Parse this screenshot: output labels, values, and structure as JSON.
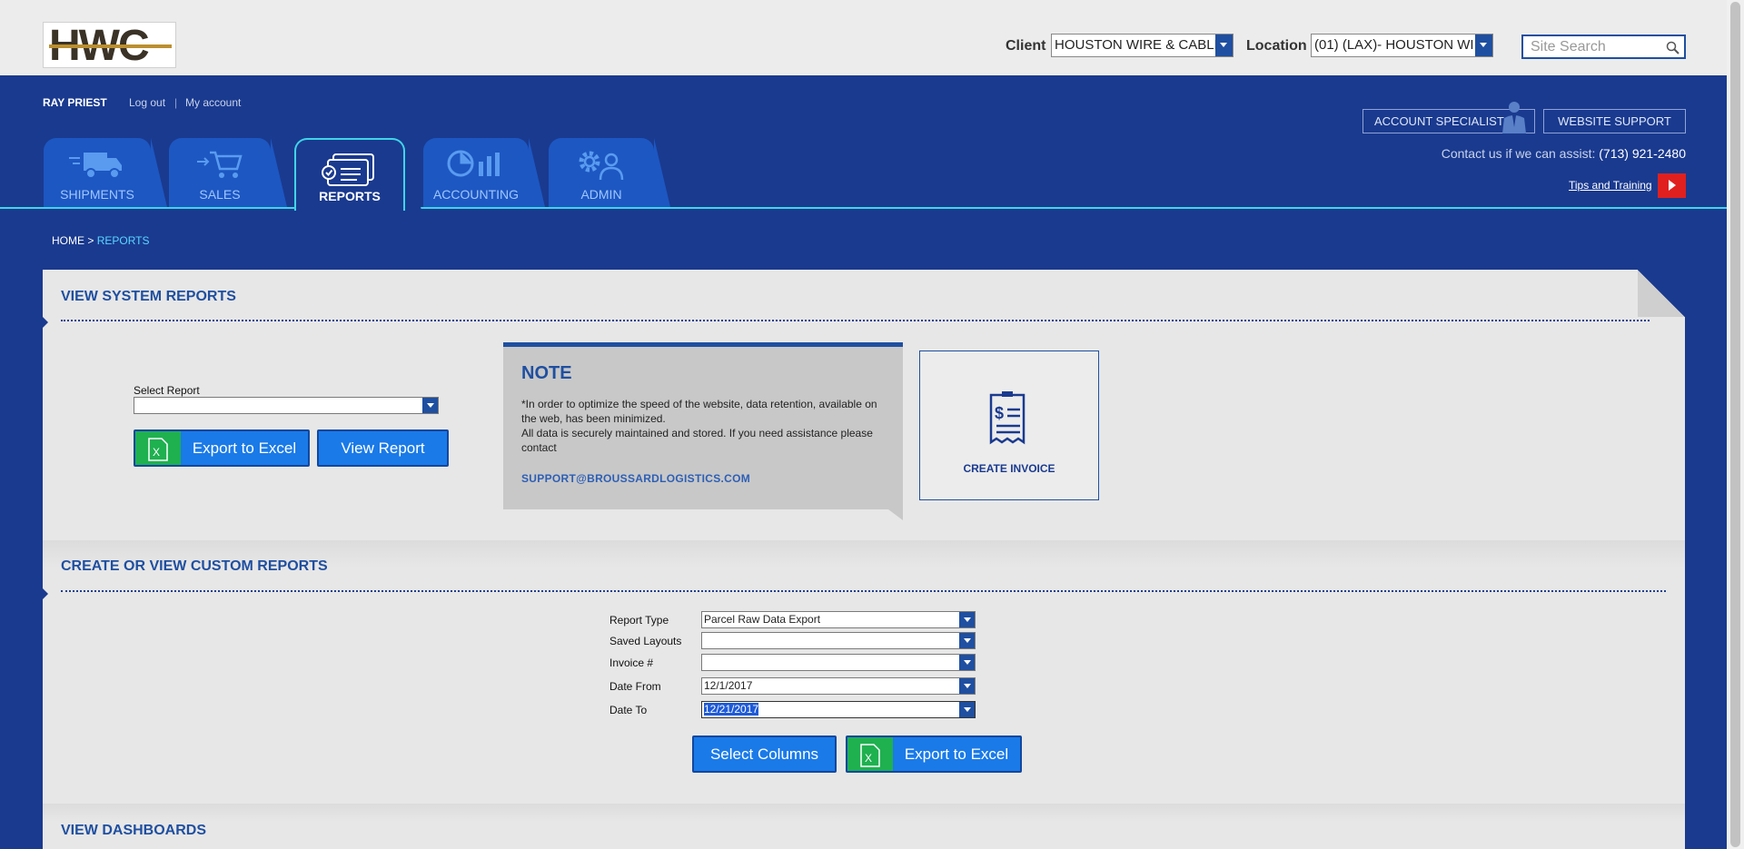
{
  "logo": {
    "text": "HWC"
  },
  "topbar": {
    "client_label": "Client",
    "client_value": "HOUSTON WIRE & CABLE",
    "location_label": "Location",
    "location_value": "(01) (LAX)- HOUSTON WI",
    "search_placeholder": "Site Search"
  },
  "user": {
    "name": "RAY PRIEST",
    "logout": "Log out",
    "separator": "|",
    "account": "My account"
  },
  "tabs": [
    {
      "label": "SHIPMENTS",
      "icon": "truck-icon"
    },
    {
      "label": "SALES",
      "icon": "cart-icon"
    },
    {
      "label": "REPORTS",
      "icon": "reports-icon",
      "active": true
    },
    {
      "label": "ACCOUNTING",
      "icon": "chart-icon"
    },
    {
      "label": "ADMIN",
      "icon": "admin-gear-icon"
    }
  ],
  "support": {
    "account_specialist": "ACCOUNT SPECIALIST",
    "website_support": "WEBSITE SUPPORT",
    "contact_text": "Contact us if we can assist:",
    "phone": "(713) 921-2480",
    "tips": "Tips and Training"
  },
  "breadcrumb": {
    "home": "HOME",
    "sep": ">",
    "current": "REPORTS"
  },
  "system_reports": {
    "title": "VIEW SYSTEM REPORTS",
    "select_label": "Select Report",
    "select_value": "",
    "export_label": "Export to Excel",
    "view_label": "View Report"
  },
  "note": {
    "title": "NOTE",
    "line1": "*In order to optimize the speed of the website, data retention, available on the web, has been minimized.",
    "line2": "All data is securely maintained and stored. If you need assistance please contact",
    "email": "SUPPORT@BROUSSARDLOGISTICS.COM"
  },
  "invoice": {
    "label": "CREATE INVOICE"
  },
  "custom_reports": {
    "title": "CREATE OR VIEW CUSTOM REPORTS",
    "fields": [
      {
        "label": "Report Type",
        "value": "Parcel Raw Data Export"
      },
      {
        "label": "Saved Layouts",
        "value": ""
      },
      {
        "label": "Invoice #",
        "value": ""
      },
      {
        "label": "Date From",
        "value": "12/1/2017"
      },
      {
        "label": "Date To",
        "value": "12/21/2017"
      }
    ],
    "select_columns": "Select Columns",
    "export_label": "Export to Excel"
  },
  "dashboards": {
    "title": "VIEW DASHBOARDS"
  },
  "colors": {
    "navy": "#1a3a8f",
    "accent": "#40d4e8",
    "button": "#1a7ae8",
    "excel": "#1fb050",
    "alert": "#e0201f"
  }
}
